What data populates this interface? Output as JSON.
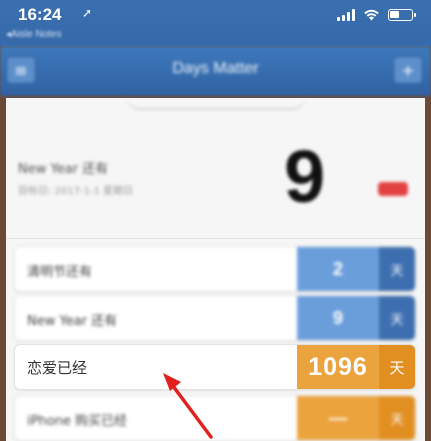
{
  "status_bar": {
    "time": "16:24",
    "back_app": "◂Aisle Notes"
  },
  "nav": {
    "title": "Days Matter",
    "menu_icon": "hamburger-icon",
    "add_icon": "plus-icon"
  },
  "feature": {
    "title": "New Year 还有",
    "date": "目标日: 2017-1-1 星期日",
    "days": "9"
  },
  "rows": [
    {
      "label": "清明节还有",
      "days": "2",
      "unit": "天",
      "color": "#6a9edb"
    },
    {
      "label": "New Year 还有",
      "days": "9",
      "unit": "天",
      "color": "#6a9edb"
    },
    {
      "label": "恋爱已经",
      "days": "1096",
      "unit": "天",
      "color": "#eba33e"
    },
    {
      "label": "iPhone 购买已经",
      "days": "—",
      "unit": "天",
      "color": "#eba33e"
    }
  ],
  "annotation": {
    "arrow_color": "#e0211e"
  }
}
